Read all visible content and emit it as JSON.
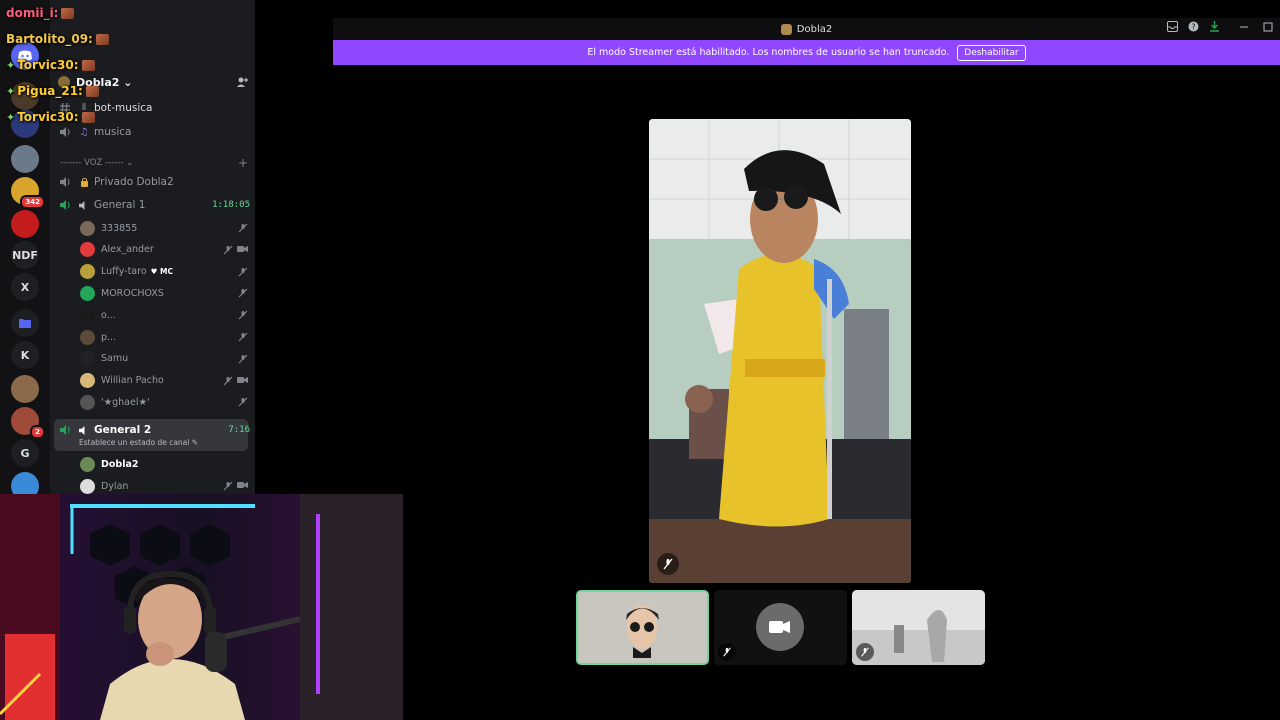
{
  "titlebar": {
    "title": "Dobla2"
  },
  "banner": {
    "text": "El modo Streamer está habilitado. Los nombres de usuario se han truncado.",
    "button": "Deshabilitar"
  },
  "chat": [
    {
      "user": "domii_i:",
      "color": "#ff5b7e",
      "star": false
    },
    {
      "user": "Bartolito_09:",
      "color": "#f0c64b",
      "star": false
    },
    {
      "user": "Torvic30:",
      "color": "#ffcc33",
      "star": true
    },
    {
      "user": "Pigua_21:",
      "color": "#ffcc33",
      "star": true
    },
    {
      "user": "Torvic30:",
      "color": "#ffcc33",
      "star": true
    }
  ],
  "servers": {
    "badge_342": "342",
    "badge_2": "2",
    "ndf": "NDF",
    "x": "X",
    "k": "K",
    "g": "G"
  },
  "guild": {
    "name": "Dobla2 ⌄"
  },
  "channels": {
    "text1": "bot-musica",
    "voice_music": "musica",
    "category": "------- VOZ ------ ⌄",
    "private": "Privado Dobla2",
    "general1": "General 1",
    "general1_timer": "1:18:05",
    "general2": "General 2",
    "general2_timer": "7:16",
    "general2_status": "Establece un estado de canal ✎"
  },
  "general1_users": [
    "333855",
    "Alex_ander",
    "Luffy-taro",
    "MOROCHOXS",
    "o...",
    "p...",
    "Samu",
    "Willian Pacho",
    "'★ghael★'"
  ],
  "mc_tag": "♥ MC",
  "general2_users": [
    "Dobla2",
    "Dylan"
  ],
  "colors": {
    "streamer_purple": "#9147ff",
    "voice_green": "#23a55a",
    "speaking_border": "#6cd89b"
  }
}
